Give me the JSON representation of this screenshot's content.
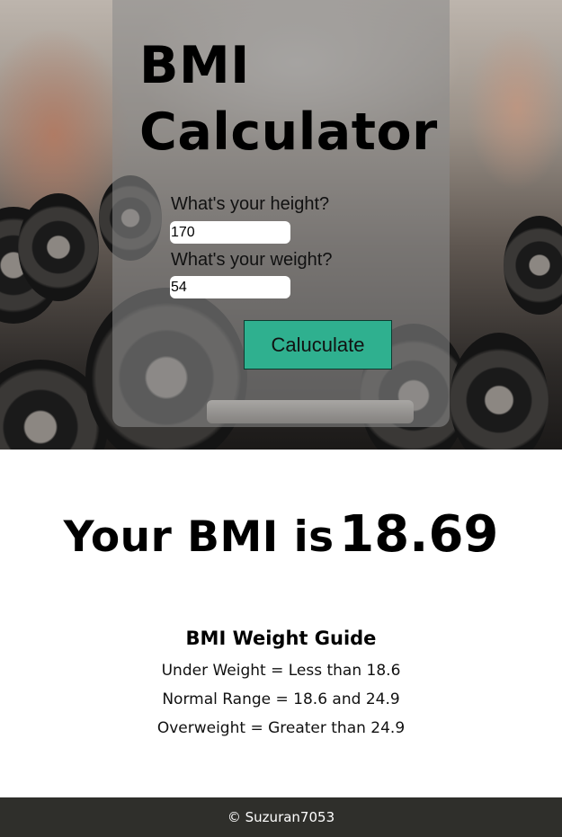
{
  "hero": {
    "background_icon": "gym-dumbbells-photo"
  },
  "card": {
    "title": "BMI Calculator",
    "height_label": "What's your height?",
    "height_value": "170",
    "weight_label": "What's your weight?",
    "weight_value": "54",
    "button_label": "Caluculate",
    "button_color": "#2fb08f"
  },
  "result": {
    "prefix": "Your BMI is",
    "value": "18.69"
  },
  "guide": {
    "title": "BMI Weight Guide",
    "lines": [
      "Under Weight = Less than 18.6",
      "Normal Range = 18.6 and 24.9",
      "Overweight = Greater than 24.9"
    ]
  },
  "footer": {
    "text": "© Suzuran7053",
    "background": "#2f2f2b"
  }
}
